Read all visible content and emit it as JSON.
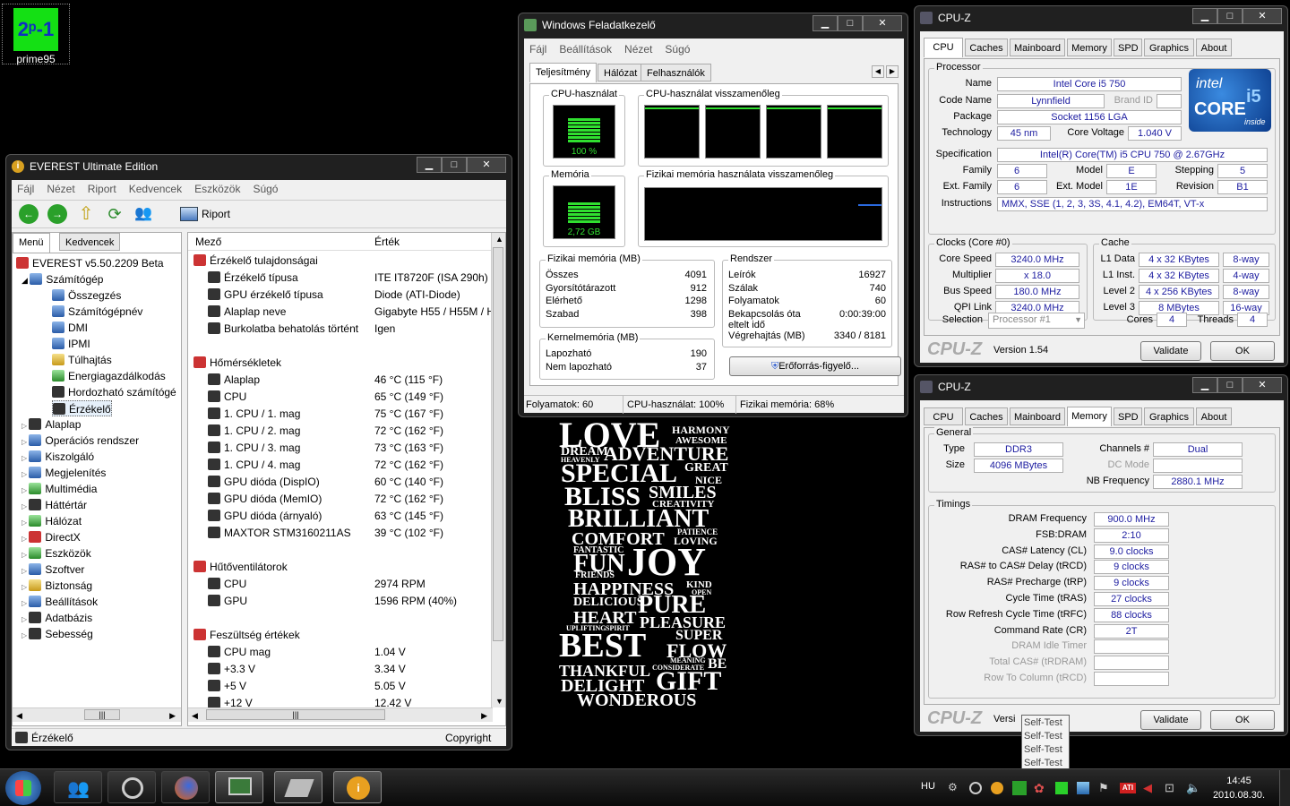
{
  "desktop": {
    "prime95_label": "prime95",
    "prime95_icon_text": "2ᵖ-1"
  },
  "everest": {
    "title": "EVEREST Ultimate Edition",
    "menu": [
      "Fájl",
      "Nézet",
      "Riport",
      "Kedvencek",
      "Eszközök",
      "Súgó"
    ],
    "toolbar_report": "Riport",
    "left_tabs": [
      "Menü",
      "Kedvencek"
    ],
    "tree_root": "EVEREST v5.50.2209 Beta",
    "tree_computer": "Számítógép",
    "tree_computer_children": [
      "Összegzés",
      "Számítógépnév",
      "DMI",
      "IPMI",
      "Túlhajtás",
      "Energiagazdálkodás",
      "Hordozható számítógé",
      "Érzékelő"
    ],
    "tree_sections": [
      "Alaplap",
      "Operációs rendszer",
      "Kiszolgáló",
      "Megjelenítés",
      "Multimédia",
      "Háttértár",
      "Hálózat",
      "DirectX",
      "Eszközök",
      "Szoftver",
      "Biztonság",
      "Beállítások",
      "Adatbázis",
      "Sebesség"
    ],
    "col_field": "Mező",
    "col_value": "Érték",
    "rows": [
      {
        "group": true,
        "f": "Érzékelő tulajdonságai",
        "v": ""
      },
      {
        "f": "Érzékelő típusa",
        "v": "ITE IT8720F  (ISA 290h)"
      },
      {
        "f": "GPU érzékelő típusa",
        "v": "Diode  (ATI-Diode)"
      },
      {
        "f": "Alaplap neve",
        "v": "Gigabyte H55 / H55M / H"
      },
      {
        "f": "Burkolatba behatolás történt",
        "v": "Igen"
      },
      {
        "blank": true,
        "f": "",
        "v": ""
      },
      {
        "group": true,
        "f": "Hőmérsékletek",
        "v": ""
      },
      {
        "f": "Alaplap",
        "v": "46 °C  (115 °F)"
      },
      {
        "f": "CPU",
        "v": "65 °C  (149 °F)"
      },
      {
        "f": "1. CPU / 1. mag",
        "v": "75 °C  (167 °F)"
      },
      {
        "f": "1. CPU / 2. mag",
        "v": "72 °C  (162 °F)"
      },
      {
        "f": "1. CPU / 3. mag",
        "v": "73 °C  (163 °F)"
      },
      {
        "f": "1. CPU / 4. mag",
        "v": "72 °C  (162 °F)"
      },
      {
        "f": "GPU dióda (DispIO)",
        "v": "60 °C  (140 °F)"
      },
      {
        "f": "GPU dióda (MemIO)",
        "v": "72 °C  (162 °F)"
      },
      {
        "f": "GPU dióda (árnyaló)",
        "v": "63 °C  (145 °F)"
      },
      {
        "f": "MAXTOR STM3160211AS",
        "v": "39 °C  (102 °F)"
      },
      {
        "blank": true,
        "f": "",
        "v": ""
      },
      {
        "group": true,
        "f": "Hűtőventilátorok",
        "v": ""
      },
      {
        "f": "CPU",
        "v": "2974 RPM"
      },
      {
        "f": "GPU",
        "v": "1596 RPM  (40%)"
      },
      {
        "blank": true,
        "f": "",
        "v": ""
      },
      {
        "group": true,
        "f": "Feszültség értékek",
        "v": ""
      },
      {
        "f": "CPU mag",
        "v": "1.04 V"
      },
      {
        "f": "+3.3 V",
        "v": "3.34 V"
      },
      {
        "f": "+5 V",
        "v": "5.05 V"
      },
      {
        "f": "+12 V",
        "v": "12.42 V"
      }
    ],
    "status_left": "Érzékelő",
    "status_right": "Copyright"
  },
  "taskmgr": {
    "title": "Windows Feladatkezelő",
    "menu": [
      "Fájl",
      "Beállítások",
      "Nézet",
      "Súgó"
    ],
    "tabs": [
      "Teljesítmény",
      "Hálózat",
      "Felhasználók"
    ],
    "cpu_usage_label": "CPU-használat",
    "cpu_usage_value": "100 %",
    "cpu_usage_fraction": 1.0,
    "cpu_history_label": "CPU-használat visszamenőleg",
    "mem_label": "Memória",
    "mem_value": "2,72 GB",
    "mem_fraction": 0.68,
    "mem_history_label": "Fizikai memória használata visszamenőleg",
    "physmem_title": "Fizikai memória (MB)",
    "physmem": [
      [
        "Összes",
        "4091"
      ],
      [
        "Gyorsítótárazott",
        "912"
      ],
      [
        "Elérhető",
        "1298"
      ],
      [
        "Szabad",
        "398"
      ]
    ],
    "kernel_title": "Kernelmemória (MB)",
    "kernel": [
      [
        "Lapozható",
        "190"
      ],
      [
        "Nem lapozható",
        "37"
      ]
    ],
    "system_title": "Rendszer",
    "system": [
      [
        "Leírók",
        "16927"
      ],
      [
        "Szálak",
        "740"
      ],
      [
        "Folyamatok",
        "60"
      ],
      [
        "Bekapcsolás óta eltelt idő",
        "0:00:39:00"
      ],
      [
        "Végrehajtás (MB)",
        "3340 / 8181"
      ]
    ],
    "resource_btn": "Erőforrás-figyelő...",
    "status": [
      "Folyamatok: 60",
      "CPU-használat: 100%",
      "Fizikai memória: 68%"
    ]
  },
  "cpuz1": {
    "title": "CPU-Z",
    "tabs": [
      "CPU",
      "Caches",
      "Mainboard",
      "Memory",
      "SPD",
      "Graphics",
      "About"
    ],
    "processor_group": "Processor",
    "name_l": "Name",
    "name": "Intel Core i5 750",
    "codename_l": "Code Name",
    "codename": "Lynnfield",
    "brandid_l": "Brand ID",
    "brandid": "",
    "package_l": "Package",
    "package": "Socket 1156 LGA",
    "technology_l": "Technology",
    "technology": "45 nm",
    "corevoltage_l": "Core Voltage",
    "corevoltage": "1.040 V",
    "spec_l": "Specification",
    "spec": "Intel(R) Core(TM) i5 CPU       750  @ 2.67GHz",
    "family_l": "Family",
    "family": "6",
    "model_l": "Model",
    "model": "E",
    "stepping_l": "Stepping",
    "stepping": "5",
    "extfamily_l": "Ext. Family",
    "extfamily": "6",
    "extmodel_l": "Ext. Model",
    "extmodel": "1E",
    "revision_l": "Revision",
    "revision": "B1",
    "instr_l": "Instructions",
    "instr": "MMX, SSE (1, 2, 3, 3S, 4.1, 4.2), EM64T, VT-x",
    "clocks_group": "Clocks (Core #0)",
    "corespeed_l": "Core Speed",
    "corespeed": "3240.0 MHz",
    "multiplier_l": "Multiplier",
    "multiplier": "x 18.0",
    "busspeed_l": "Bus Speed",
    "busspeed": "180.0 MHz",
    "qpilink_l": "QPI Link",
    "qpilink": "3240.0 MHz",
    "cache_group": "Cache",
    "l1d_l": "L1 Data",
    "l1d": "4 x 32 KBytes",
    "l1d_w": "8-way",
    "l1i_l": "L1 Inst.",
    "l1i": "4 x 32 KBytes",
    "l1i_w": "4-way",
    "l2_l": "Level 2",
    "l2": "4 x 256 KBytes",
    "l2_w": "8-way",
    "l3_l": "Level 3",
    "l3": "8 MBytes",
    "l3_w": "16-way",
    "selection_l": "Selection",
    "selection": "Processor #1",
    "cores_l": "Cores",
    "cores": "4",
    "threads_l": "Threads",
    "threads": "4",
    "brand": "CPU-Z",
    "version": "Version 1.54",
    "validate": "Validate",
    "ok": "OK",
    "logo_intel": "intel",
    "logo_core": "CORE",
    "logo_i5": "i5",
    "logo_inside": "inside"
  },
  "cpuz2": {
    "title": "CPU-Z",
    "tabs": [
      "CPU",
      "Caches",
      "Mainboard",
      "Memory",
      "SPD",
      "Graphics",
      "About"
    ],
    "general_group": "General",
    "type_l": "Type",
    "type": "DDR3",
    "channels_l": "Channels #",
    "channels": "Dual",
    "size_l": "Size",
    "size": "4096 MBytes",
    "dcmode_l": "DC Mode",
    "dcmode": "",
    "nbfreq_l": "NB Frequency",
    "nbfreq": "2880.1 MHz",
    "timings_group": "Timings",
    "timings": [
      [
        "DRAM Frequency",
        "900.0 MHz"
      ],
      [
        "FSB:DRAM",
        "2:10"
      ],
      [
        "CAS# Latency (CL)",
        "9.0 clocks"
      ],
      [
        "RAS# to CAS# Delay (tRCD)",
        "9 clocks"
      ],
      [
        "RAS# Precharge (tRP)",
        "9 clocks"
      ],
      [
        "Cycle Time (tRAS)",
        "27 clocks"
      ],
      [
        "Row Refresh Cycle Time (tRFC)",
        "88 clocks"
      ],
      [
        "Command Rate (CR)",
        "2T"
      ],
      [
        "DRAM Idle Timer",
        ""
      ],
      [
        "Total CAS# (tRDRAM)",
        ""
      ],
      [
        "Row To Column (tRCD)",
        ""
      ]
    ],
    "brand": "CPU-Z",
    "version": "Versi",
    "validate": "Validate",
    "ok": "OK"
  },
  "tooltip": [
    "Self-Test",
    "Self-Test",
    "Self-Test",
    "Self-Test"
  ],
  "wallpaper_words": [
    "LOVE",
    "HARMONY",
    "AWESOME",
    "DREAM",
    "ADVENTURE",
    "HEAVENLY",
    "SPECIAL",
    "GREAT",
    "NICE",
    "BLISS",
    "SMILES",
    "CREATIVITY",
    "BRILLIANT",
    "COMFORT",
    "PATIENCE",
    "LOVING",
    "FANTASTIC",
    "FUN",
    "JOY",
    "FRIENDS",
    "HAPPINESS",
    "KIND",
    "OPEN",
    "DELICIOUS",
    "PURE",
    "HEART",
    "PLEASURE",
    "UPLIFTING",
    "SPIRIT",
    "BEST",
    "SUPER",
    "FLOW",
    "MEANING",
    "THANKFUL",
    "CONSIDERATE",
    "BE",
    "DELIGHT",
    "GIFT",
    "WONDEROUS"
  ],
  "taskbar": {
    "lang": "HU",
    "time": "14:45",
    "date": "2010.08.30."
  }
}
